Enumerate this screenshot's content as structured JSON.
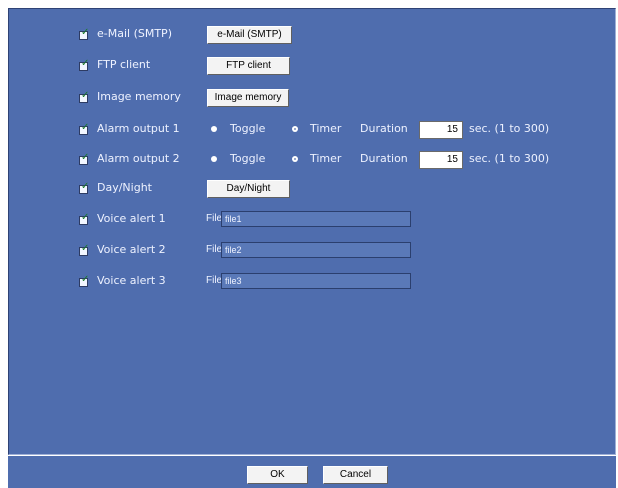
{
  "rows": [
    {
      "label": "e-Mail (SMTP)",
      "button": "e-Mail (SMTP)"
    },
    {
      "label": "FTP client",
      "button": "FTP client"
    },
    {
      "label": "Image memory",
      "button": "Image memory"
    },
    {
      "label": "Alarm output 1",
      "toggle": "Toggle",
      "timer": "Timer",
      "duration_label": "Duration",
      "duration": "15",
      "range": "sec. (1 to 300)",
      "selected": "Timer"
    },
    {
      "label": "Alarm output 2",
      "toggle": "Toggle",
      "timer": "Timer",
      "duration_label": "Duration",
      "duration": "15",
      "range": "sec. (1 to 300)",
      "selected": "Timer"
    },
    {
      "label": "Day/Night",
      "button": "Day/Night"
    },
    {
      "label": "Voice alert 1",
      "file_label": "File",
      "file": "file1"
    },
    {
      "label": "Voice alert 2",
      "file_label": "File",
      "file": "file2"
    },
    {
      "label": "Voice alert 3",
      "file_label": "File",
      "file": "file3"
    }
  ],
  "footer": {
    "ok": "OK",
    "cancel": "Cancel"
  },
  "colors": {
    "panel": "#4f6dae",
    "text": "#eef2ff",
    "check": "#1c7b2d"
  }
}
